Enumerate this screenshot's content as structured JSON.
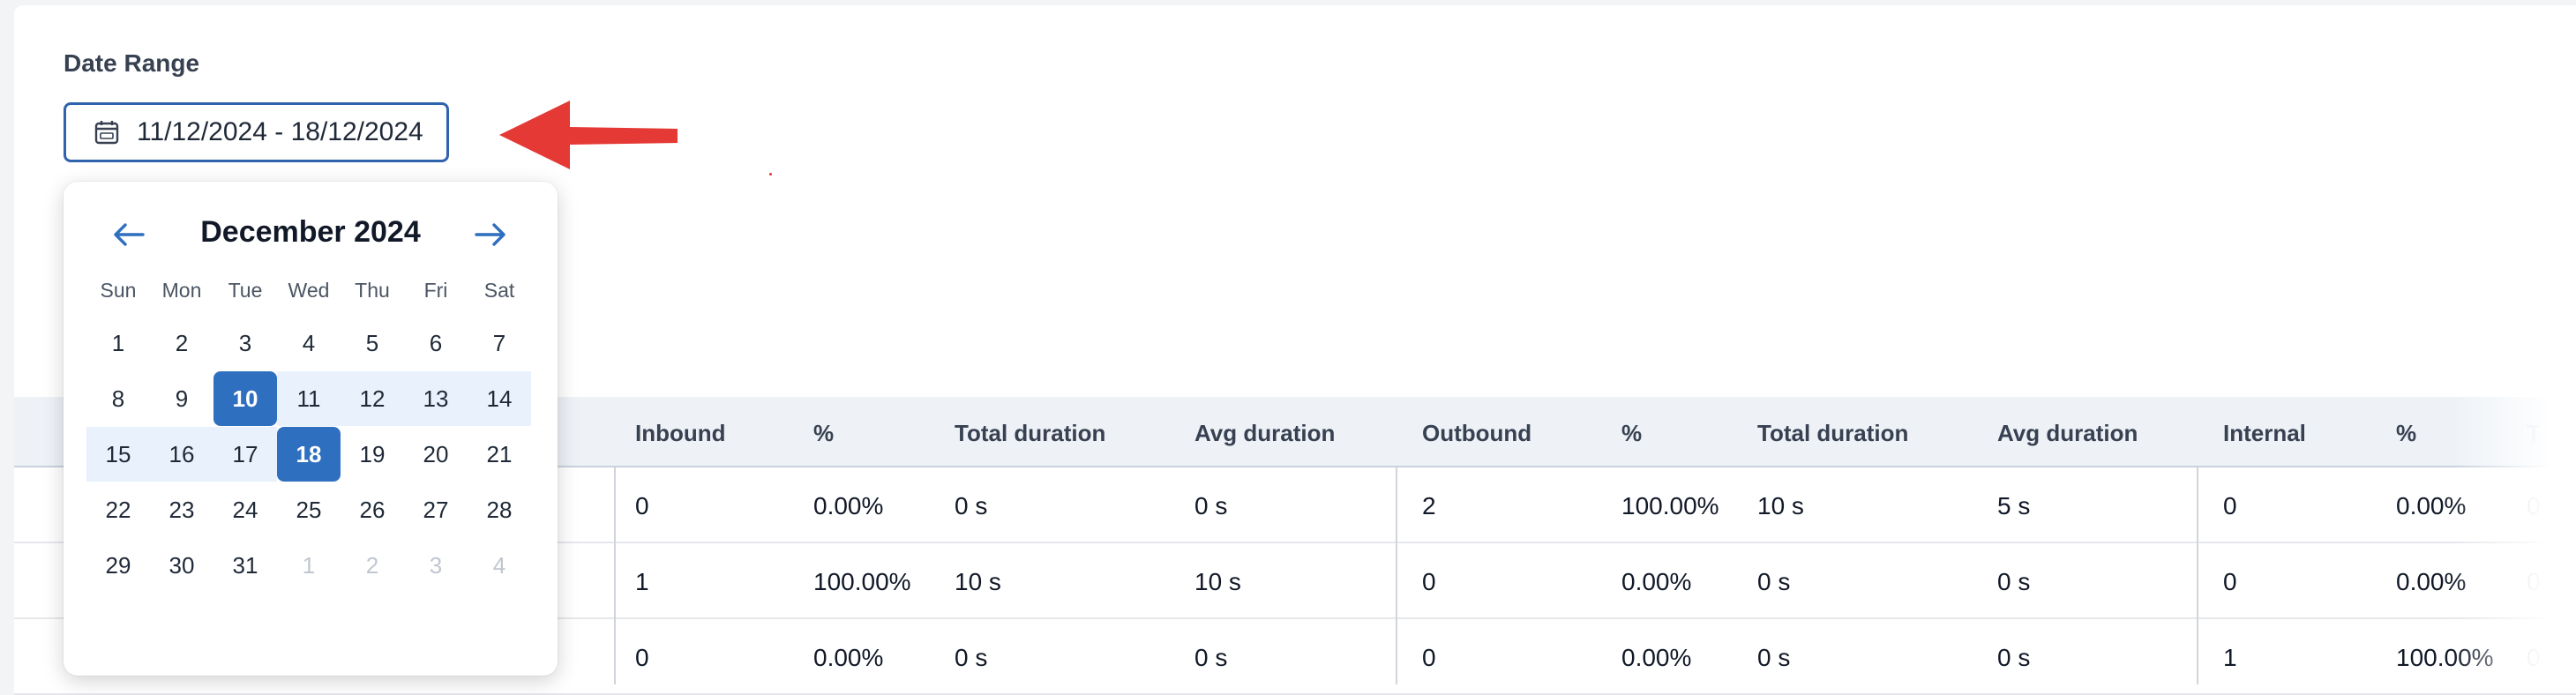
{
  "filter": {
    "label": "Date Range",
    "value": "11/12/2024 - 18/12/2024",
    "icon": "calendar-icon"
  },
  "calendar": {
    "month_title": "December 2024",
    "prev_icon": "arrow-left-icon",
    "next_icon": "arrow-right-icon",
    "weekdays": [
      "Sun",
      "Mon",
      "Tue",
      "Wed",
      "Thu",
      "Fri",
      "Sat"
    ],
    "weeks": [
      [
        "1",
        "2",
        "3",
        "4",
        "5",
        "6",
        "7"
      ],
      [
        "8",
        "9",
        "10",
        "11",
        "12",
        "13",
        "14"
      ],
      [
        "15",
        "16",
        "17",
        "18",
        "19",
        "20",
        "21"
      ],
      [
        "22",
        "23",
        "24",
        "25",
        "26",
        "27",
        "28"
      ],
      [
        "29",
        "30",
        "31",
        "1",
        "2",
        "3",
        "4"
      ]
    ],
    "range_start": "10",
    "range_end": "18",
    "accent_color": "#2f6fbf",
    "range_color": "#e8f1fc"
  },
  "annotation": {
    "arrow_color": "#e53935"
  },
  "table": {
    "headers": [
      "Inbound",
      "%",
      "Total duration",
      "Avg duration",
      "Outbound",
      "%",
      "Total duration",
      "Avg duration",
      "Internal",
      "%",
      "T"
    ],
    "rows": [
      [
        "0",
        "0.00%",
        "0 s",
        "0 s",
        "2",
        "100.00%",
        "10 s",
        "5 s",
        "0",
        "0.00%",
        "0"
      ],
      [
        "1",
        "100.00%",
        "10 s",
        "10 s",
        "0",
        "0.00%",
        "0 s",
        "0 s",
        "0",
        "0.00%",
        "0"
      ],
      [
        "0",
        "0.00%",
        "0 s",
        "0 s",
        "0",
        "0.00%",
        "0 s",
        "0 s",
        "1",
        "100.00%",
        "0"
      ]
    ]
  }
}
